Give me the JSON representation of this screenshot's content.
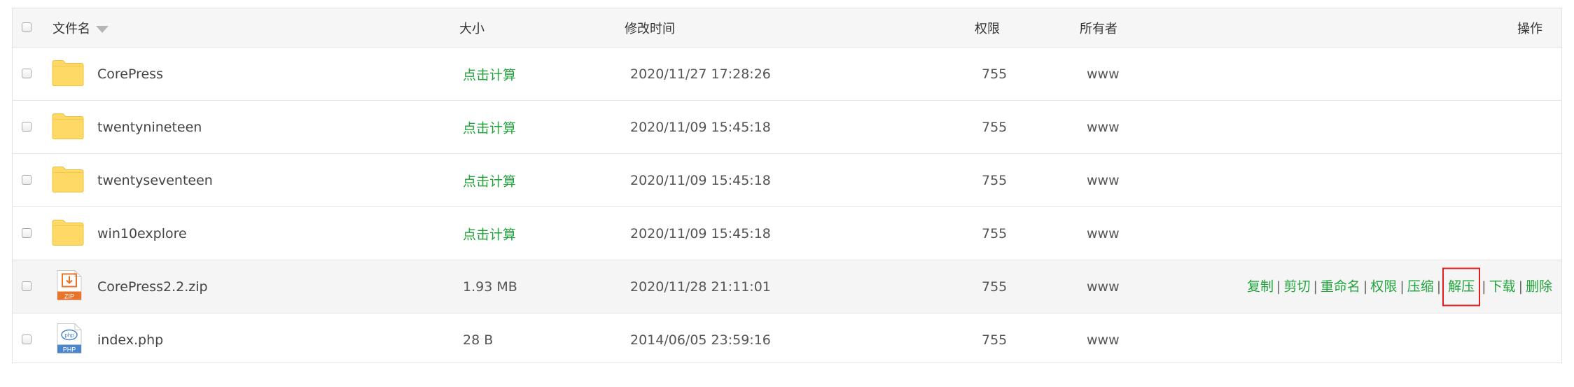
{
  "header": {
    "name": "文件名",
    "size": "大小",
    "mtime": "修改时间",
    "perm": "权限",
    "owner": "所有者",
    "ops": "操作"
  },
  "rows": [
    {
      "name": "CorePress",
      "size": "点击计算",
      "mtime": "2020/11/27 17:28:26",
      "perm": "755",
      "owner": "www",
      "type": "folder"
    },
    {
      "name": "twentynineteen",
      "size": "点击计算",
      "mtime": "2020/11/09 15:45:18",
      "perm": "755",
      "owner": "www",
      "type": "folder"
    },
    {
      "name": "twentyseventeen",
      "size": "点击计算",
      "mtime": "2020/11/09 15:45:18",
      "perm": "755",
      "owner": "www",
      "type": "folder"
    },
    {
      "name": "win10explore",
      "size": "点击计算",
      "mtime": "2020/11/09 15:45:18",
      "perm": "755",
      "owner": "www",
      "type": "folder"
    },
    {
      "name": "CorePress2.2.zip",
      "size": "1.93 MB",
      "mtime": "2020/11/28 21:11:01",
      "perm": "755",
      "owner": "www",
      "type": "zip",
      "icon_label": "ZIP"
    },
    {
      "name": "index.php",
      "size": "28 B",
      "mtime": "2014/06/05 23:59:16",
      "perm": "755",
      "owner": "www",
      "type": "php",
      "icon_label": "PHP",
      "icon_badge": "php"
    }
  ],
  "actions": {
    "copy": "复制",
    "cut": "剪切",
    "rename": "重命名",
    "perm": "权限",
    "compress": "压缩",
    "extract": "解压",
    "download": "下载",
    "delete": "删除",
    "sep": "|"
  },
  "colors": {
    "link_green": "#20a53a",
    "folder_yellow": "#ffd966",
    "zip_orange": "#e8732a",
    "php_blue": "#4a86c8",
    "highlight_red": "#e02020"
  }
}
